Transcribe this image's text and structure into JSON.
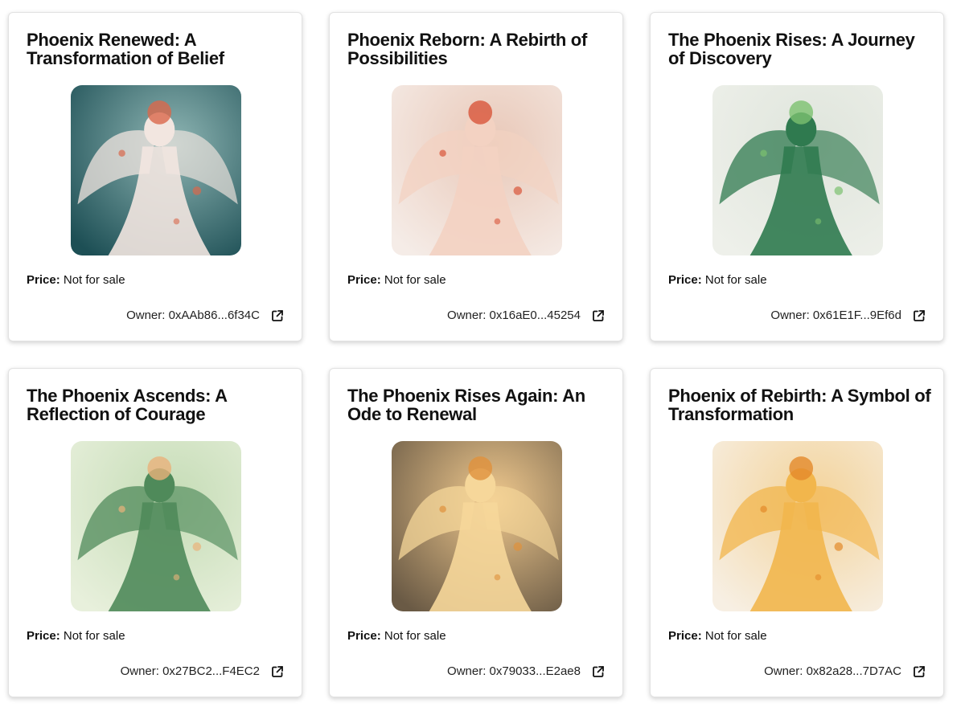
{
  "cards": [
    {
      "title": "Phoenix Renewed: A Transformation of Belief",
      "price_label": "Price:",
      "price_value": "Not for sale",
      "owner_text": "Owner: 0xAAb86...6f34C",
      "image_icon": "phoenix-artwork-teal",
      "colors": {
        "bg1": "#1d4f55",
        "bg2": "#8fb6b4",
        "figure": "#f2e6e0",
        "accent": "#d9684b"
      }
    },
    {
      "title": "Phoenix Reborn: A Rebirth of Possibilities",
      "price_label": "Price:",
      "price_value": "Not for sale",
      "owner_text": "Owner: 0x16aE0...45254",
      "image_icon": "phoenix-artwork-peach",
      "colors": {
        "bg1": "#f5ece7",
        "bg2": "#e9c8b8",
        "figure": "#f3d2c2",
        "accent": "#d8553a"
      }
    },
    {
      "title": "The Phoenix Rises: A Journey of Discovery",
      "price_label": "Price:",
      "price_value": "Not for sale",
      "owner_text": "Owner: 0x61E1F...9Ef6d",
      "image_icon": "phoenix-artwork-green",
      "colors": {
        "bg1": "#eef0ea",
        "bg2": "#dfe5dc",
        "figure": "#2f7a4f",
        "accent": "#7cc06f"
      }
    },
    {
      "title": "The Phoenix Ascends: A Reflection of Courage",
      "price_label": "Price:",
      "price_value": "Not for sale",
      "owner_text": "Owner: 0x27BC2...F4EC2",
      "image_icon": "phoenix-artwork-jade",
      "colors": {
        "bg1": "#e8f0dc",
        "bg2": "#c5dcb6",
        "figure": "#4f8a5a",
        "accent": "#e9b27a"
      }
    },
    {
      "title": "The Phoenix Rises Again: An Ode to Renewal",
      "price_label": "Price:",
      "price_value": "Not for sale",
      "owner_text": "Owner: 0x79033...E2ae8",
      "image_icon": "phoenix-artwork-amber",
      "colors": {
        "bg1": "#6a5a45",
        "bg2": "#f0c98e",
        "figure": "#f6d79a",
        "accent": "#e0913c"
      }
    },
    {
      "title": "Phoenix of Rebirth: A Symbol of Transformation",
      "price_label": "Price:",
      "price_value": "Not for sale",
      "owner_text": "Owner: 0x82a28...7D7AC",
      "image_icon": "phoenix-artwork-gold",
      "colors": {
        "bg1": "#f7efe3",
        "bg2": "#f3d39a",
        "figure": "#f2b64c",
        "accent": "#e38a2a"
      }
    }
  ]
}
